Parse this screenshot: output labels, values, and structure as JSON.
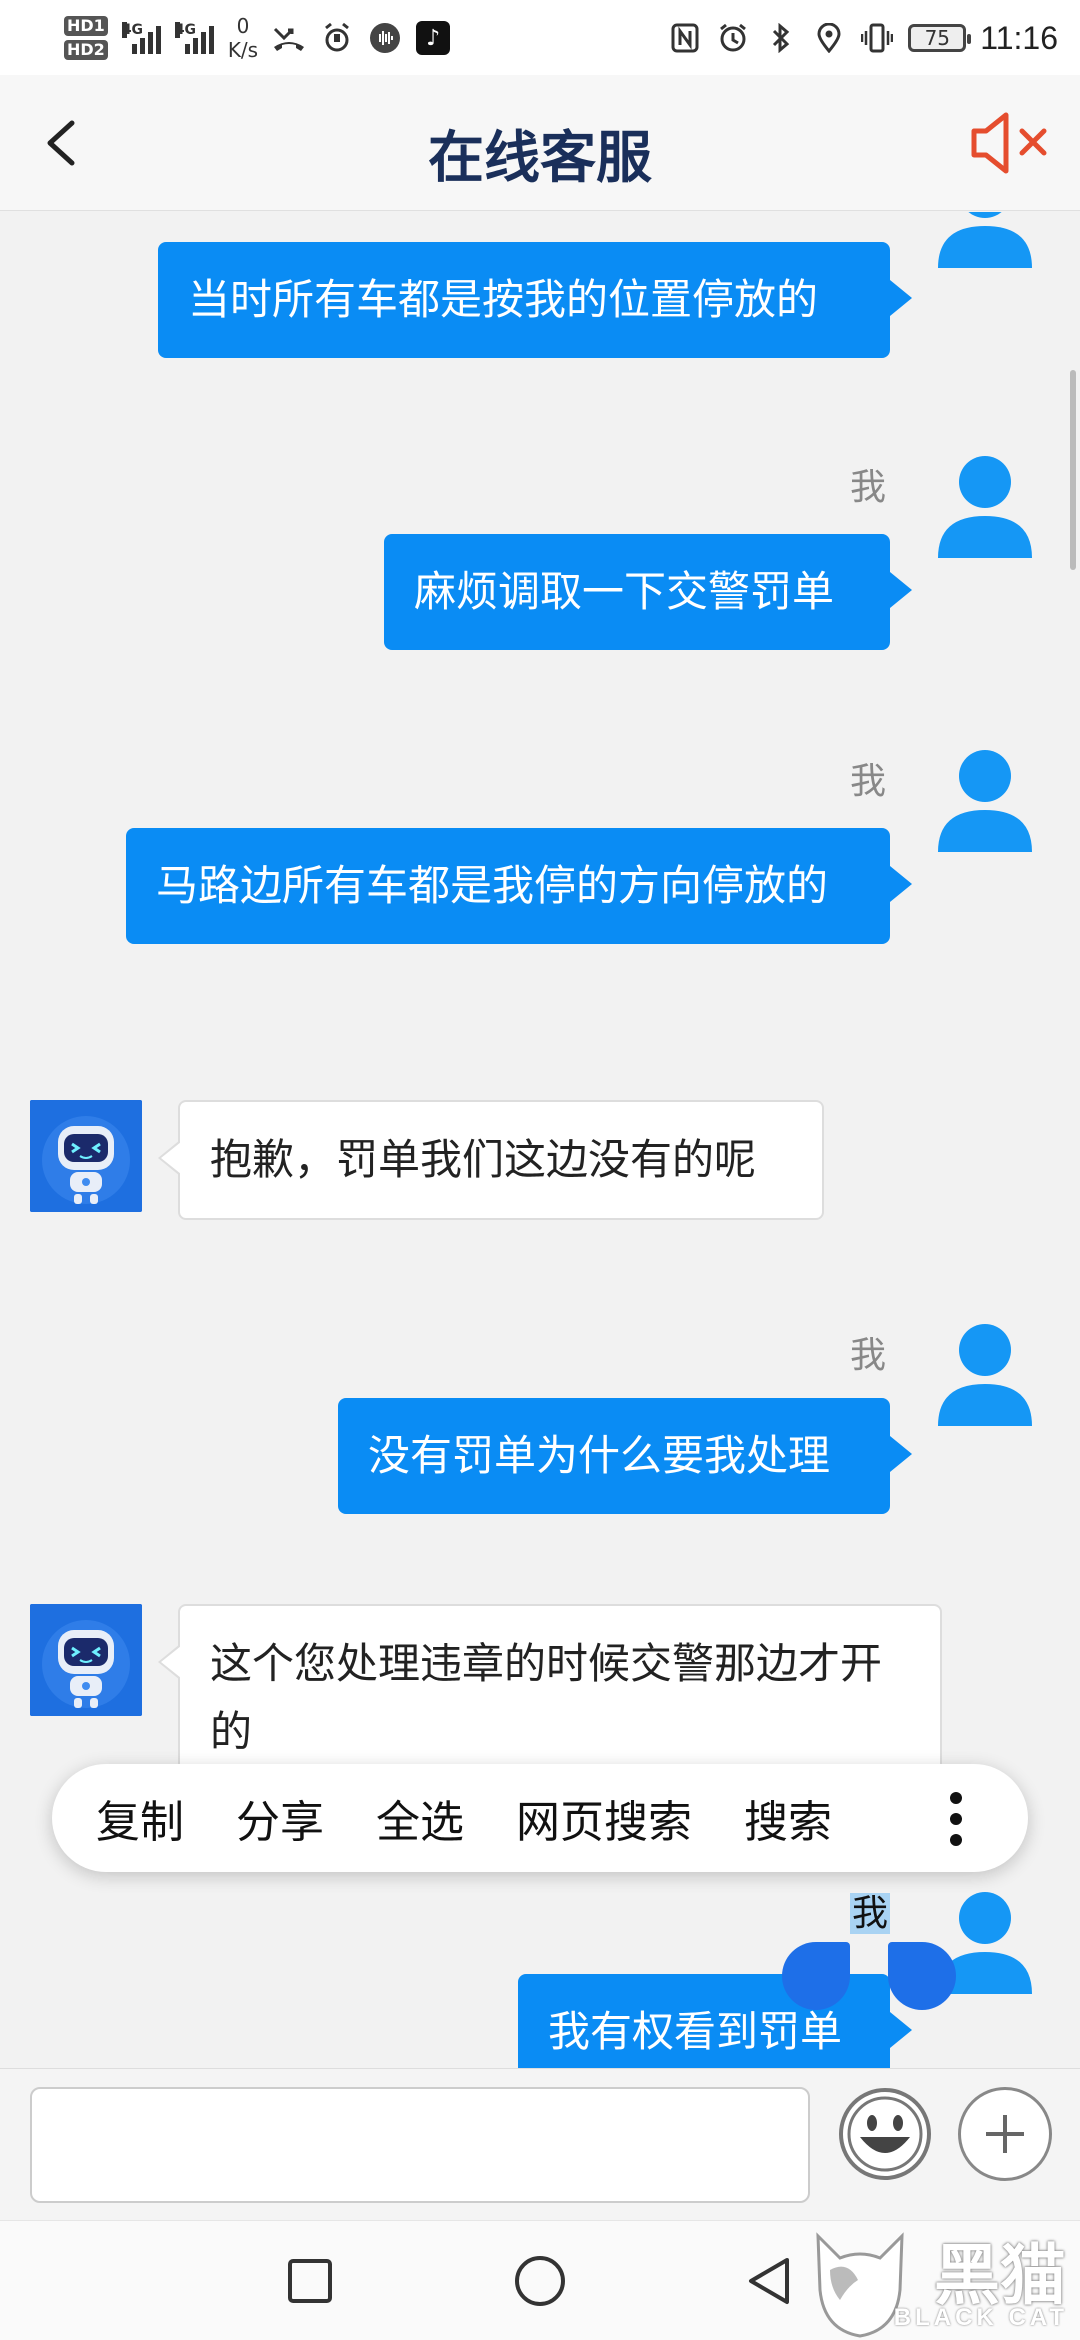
{
  "status_bar": {
    "hd1": "HD",
    "hd1_sub": "1",
    "hd2": "HD",
    "hd2_sub": "2",
    "net1": "4G",
    "net2": "4G",
    "speed_value": "0",
    "speed_unit": "K/s",
    "battery": "75",
    "time": "11:16",
    "icons": [
      "missed-call-icon",
      "alarm-icon",
      "audio-icon",
      "tiktok-icon",
      "nfc-icon",
      "alarm-clock-icon",
      "bluetooth-icon",
      "location-icon",
      "vibrate-icon"
    ]
  },
  "header": {
    "title": "在线客服",
    "back_icon": "chevron-left-icon",
    "mute_icon": "speaker-muted-icon",
    "accent_color": "#e54d2e"
  },
  "messages": [
    {
      "side": "out",
      "sender": "",
      "text": "当时所有车都是按我的位置停放的"
    },
    {
      "side": "out",
      "sender": "我",
      "text": "麻烦调取一下交警罚单"
    },
    {
      "side": "out",
      "sender": "我",
      "text": "马路边所有车都是我停的方向停放的"
    },
    {
      "side": "in",
      "sender": "",
      "text": "抱歉，罚单我们这边没有的呢"
    },
    {
      "side": "out",
      "sender": "我",
      "text": "没有罚单为什么要我处理"
    },
    {
      "side": "in",
      "sender": "",
      "text": "这个您处理违章的时候交警那边才开的"
    },
    {
      "side": "out",
      "sender": "我",
      "text": "我有权看到罚单"
    }
  ],
  "context_menu": {
    "items": [
      "复制",
      "分享",
      "全选",
      "网页搜索",
      "搜索"
    ],
    "more_icon": "more-vertical-icon"
  },
  "input": {
    "value": "",
    "placeholder": "",
    "emoji_icon": "smiley-icon",
    "plus_icon": "plus-icon"
  },
  "nav": {
    "icons": [
      "recent-apps-icon",
      "home-icon",
      "back-icon"
    ]
  },
  "watermark": {
    "text": "黑猫",
    "sub": "BLACK CAT"
  },
  "colors": {
    "bubble_out": "#0a8cf4",
    "title": "#1a2f5a",
    "chat_bg": "#f2f2f2"
  }
}
